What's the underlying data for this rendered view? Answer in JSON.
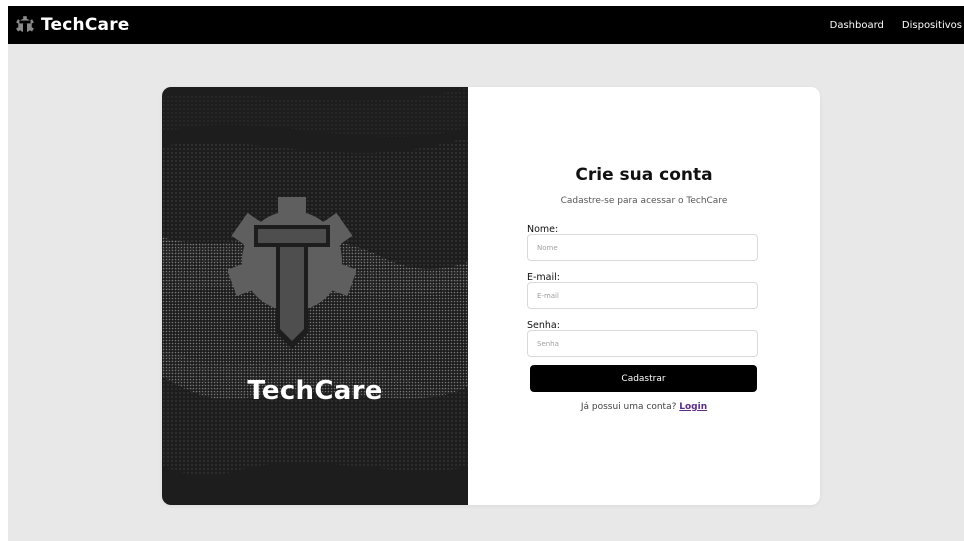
{
  "navbar": {
    "brand": "TechCare",
    "links": [
      {
        "label": "Dashboard"
      },
      {
        "label": "Dispositivos"
      }
    ]
  },
  "left_panel": {
    "title": "TechCare",
    "icon": "gear-t-logo-icon"
  },
  "form": {
    "title": "Crie sua conta",
    "subtitle": "Cadastre-se para acessar o TechCare",
    "fields": [
      {
        "label": "Nome:",
        "placeholder": "Nome",
        "value": ""
      },
      {
        "label": "E-mail:",
        "placeholder": "E-mail",
        "value": ""
      },
      {
        "label": "Senha:",
        "placeholder": "Senha",
        "value": ""
      }
    ],
    "submit_label": "Cadastrar",
    "login_prompt": "Já possui uma conta?",
    "login_link": "Login"
  },
  "colors": {
    "navbar": "#000000",
    "page_background": "#e8e8e8",
    "left_panel": "#1d1d1d",
    "button": "#000000",
    "login_link": "#5a2d8a"
  }
}
